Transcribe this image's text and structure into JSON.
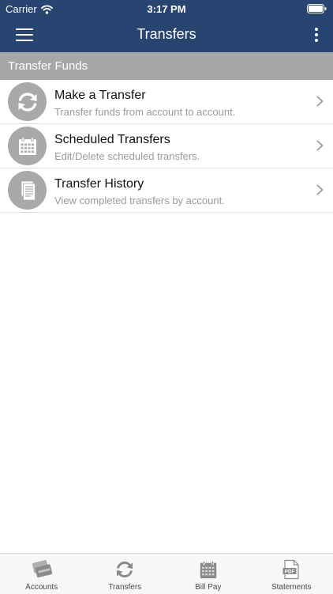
{
  "status_bar": {
    "carrier": "Carrier",
    "time": "3:17 PM",
    "icons": [
      "wifi-icon",
      "battery-icon"
    ]
  },
  "nav": {
    "title": "Transfers",
    "left_icon": "hamburger-menu-icon",
    "right_icon": "more-vertical-icon"
  },
  "section": {
    "header": "Transfer Funds"
  },
  "items": [
    {
      "title": "Make a Transfer",
      "subtitle": "Transfer funds from account to account.",
      "icon": "transfer-arrows-icon"
    },
    {
      "title": "Scheduled Transfers",
      "subtitle": "Edit/Delete scheduled transfers.",
      "icon": "calendar-icon"
    },
    {
      "title": "Transfer History",
      "subtitle": "View completed transfers by account.",
      "icon": "document-icon"
    }
  ],
  "tabs": [
    {
      "label": "Accounts",
      "icon": "cards-icon"
    },
    {
      "label": "Transfers",
      "icon": "transfer-arrows-icon"
    },
    {
      "label": "Bill Pay",
      "icon": "calendar-icon"
    },
    {
      "label": "Statements",
      "icon": "pdf-icon",
      "icon_text": "PDF"
    }
  ],
  "colors": {
    "header_bg": "#284572",
    "section_header_bg": "#a7a7a7",
    "icon_circle": "#a9a9a9",
    "tab_icon": "#8a8a8a"
  }
}
